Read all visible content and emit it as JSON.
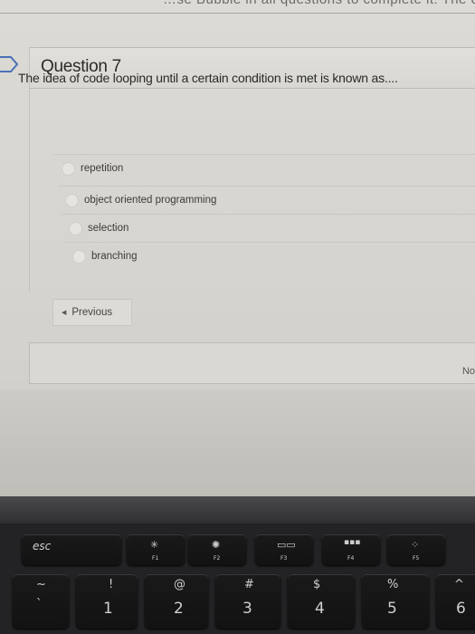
{
  "page": {
    "top_partial_text": "…se Bubble in all questions to complete it. The exam must be"
  },
  "question": {
    "number_label": "Question 7",
    "text": "The idea of code looping until a certain condition is met is known as....",
    "answers": [
      {
        "label": "repetition"
      },
      {
        "label": "object oriented programming"
      },
      {
        "label": "selection"
      },
      {
        "label": "branching"
      }
    ]
  },
  "navigation": {
    "previous_label": "Previous",
    "next_label": "No"
  },
  "keyboard": {
    "esc": "esc",
    "fkeys": [
      {
        "label": "F1",
        "icon": "brightness-down-icon"
      },
      {
        "label": "F2",
        "icon": "brightness-up-icon"
      },
      {
        "label": "F3",
        "icon": "mission-control-icon"
      },
      {
        "label": "F4",
        "icon": "launchpad-icon"
      },
      {
        "label": "F5",
        "icon": "keyboard-light-icon"
      }
    ],
    "numkeys": [
      {
        "main": "1",
        "sym": "!"
      },
      {
        "main": "2",
        "sym": "@"
      },
      {
        "main": "3",
        "sym": "#"
      },
      {
        "main": "4",
        "sym": "$"
      },
      {
        "main": "5",
        "sym": "%"
      },
      {
        "main": "6",
        "sym": "^"
      }
    ],
    "tilde": {
      "main": "`",
      "sym": "~"
    }
  },
  "colors": {
    "page_bg": "#d8d6d0",
    "text": "#2a2a2a",
    "keyboard": "#121213"
  }
}
